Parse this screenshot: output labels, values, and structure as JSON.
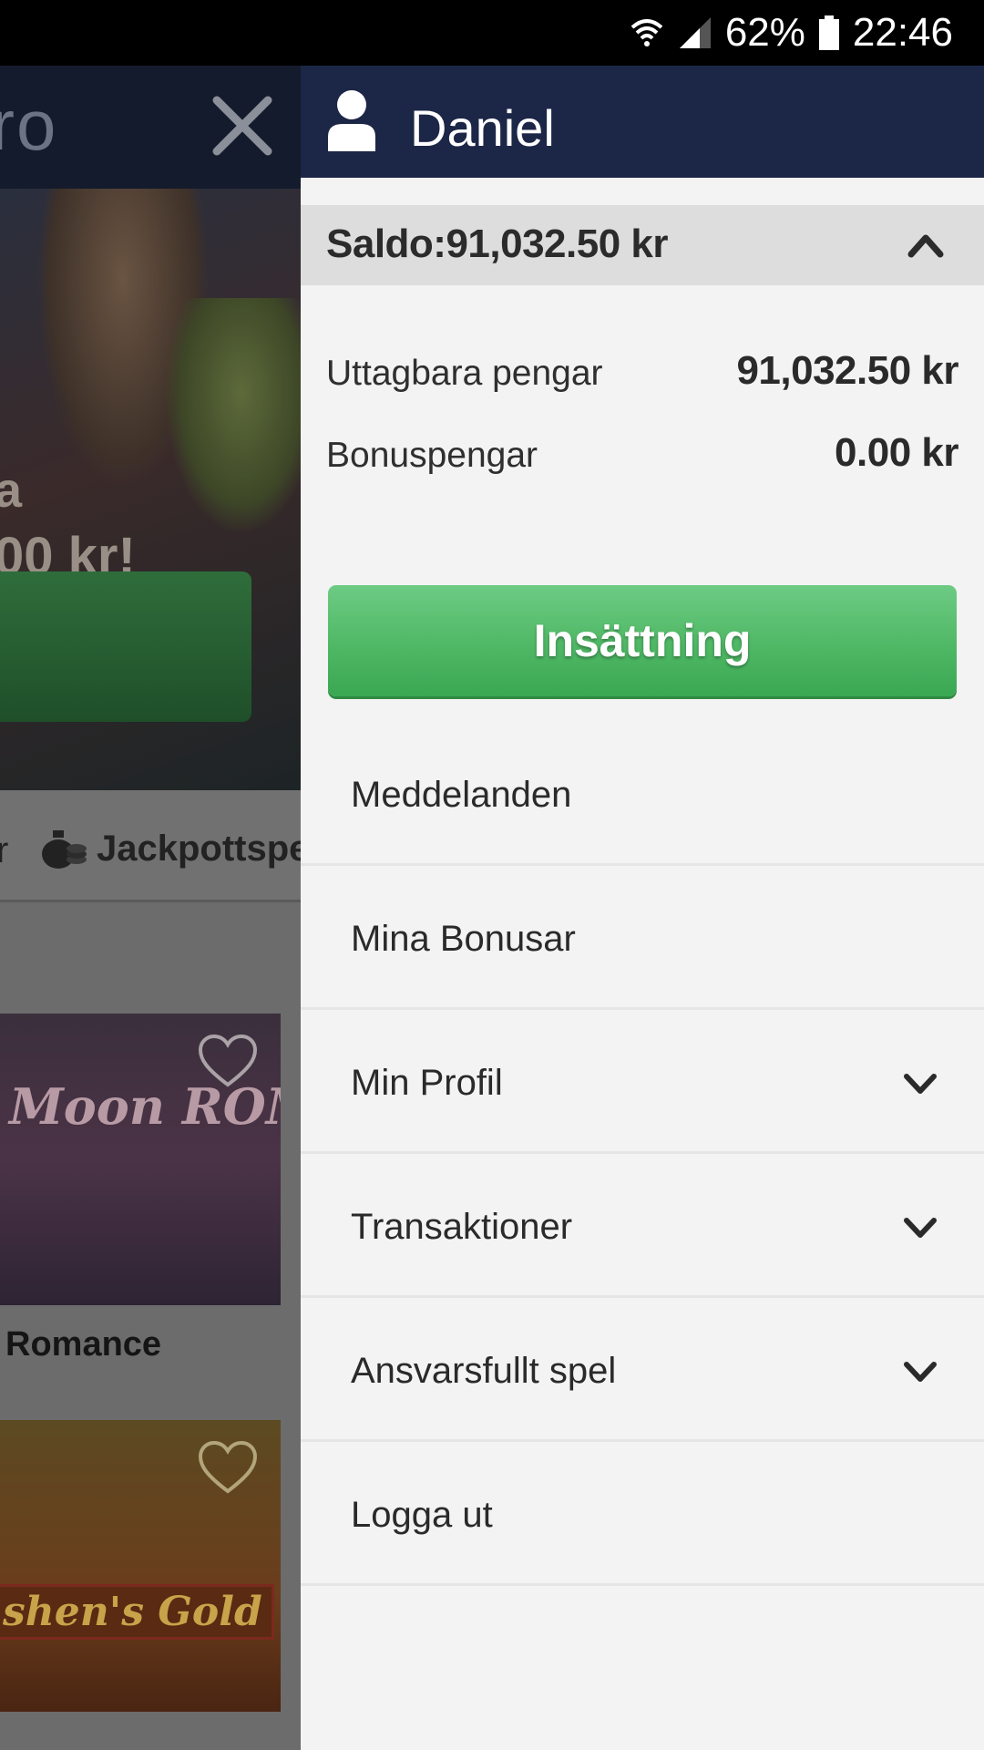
{
  "status_bar": {
    "battery_percent": "62%",
    "time": "22:46",
    "icons": [
      "wifi-icon",
      "signal-icon",
      "battery-icon"
    ]
  },
  "background_page": {
    "logo_fragment": "ro",
    "hero_line1": "a",
    "hero_line2": "00 kr!",
    "tab_fragment": "r",
    "tab_jackpot": "Jackpottspe",
    "game1_art_title": "Moon ROMANCE",
    "game1_name": "Romance",
    "game2_art_title": "shen's Gold"
  },
  "drawer": {
    "user_name": "Daniel",
    "balance_label": "Saldo:91,032.50 kr",
    "balance_expanded": true,
    "withdrawable_label": "Uttagbara pengar",
    "withdrawable_value": "91,032.50 kr",
    "bonus_label": "Bonuspengar",
    "bonus_value": "0.00 kr",
    "deposit_label": "Insättning",
    "menu": [
      {
        "label": "Meddelanden",
        "has_chevron": false
      },
      {
        "label": "Mina Bonusar",
        "has_chevron": false
      },
      {
        "label": "Min Profil",
        "has_chevron": true
      },
      {
        "label": "Transaktioner",
        "has_chevron": true
      },
      {
        "label": "Ansvarsfullt spel",
        "has_chevron": true
      },
      {
        "label": "Logga ut",
        "has_chevron": false
      }
    ]
  },
  "colors": {
    "drawer_header": "#1c2647",
    "drawer_bg": "#f2f3f2",
    "balance_bar": "#dcdddc",
    "deposit_green": "#4fb865",
    "overlay_dim": "#6f6f6f"
  }
}
